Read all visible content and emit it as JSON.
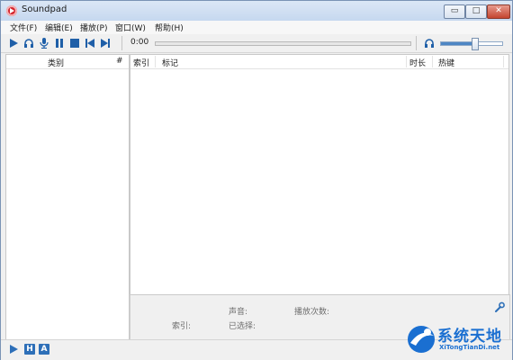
{
  "window": {
    "title": "Soundpad",
    "buttons": {
      "minimize": "▭",
      "maximize": "□",
      "close": "✕"
    }
  },
  "menu": [
    {
      "label": "文件(F)"
    },
    {
      "label": "编辑(E)"
    },
    {
      "label": "播放(P)"
    },
    {
      "label": "窗口(W)"
    },
    {
      "label": "帮助(H)"
    }
  ],
  "toolbar": {
    "icons": [
      "play-icon",
      "headphones-icon",
      "microphone-icon",
      "pause-icon",
      "stop-icon",
      "previous-icon",
      "next-icon"
    ],
    "time": "0:00",
    "progress": 0,
    "volume": 0.55,
    "volume_icon": "headphones-icon"
  },
  "categories": {
    "header_name": "类别",
    "header_count": "#",
    "items": []
  },
  "sound_list": {
    "columns": [
      "索引",
      "标记",
      "时长",
      "热键"
    ],
    "rows": []
  },
  "info": {
    "volume_label": "声音:",
    "play_count_label": "播放次数:",
    "index_label": "索引:",
    "selected_label": "已选择:",
    "settings_icon": "wrench-icon"
  },
  "statusbar": {
    "play_icon": "play-icon",
    "h_label": "H",
    "a_label": "A"
  },
  "watermark": {
    "text": "系统天地",
    "subtext": "XiTongTianDi.net"
  },
  "colors": {
    "accent": "#2d6fb8",
    "close": "#c4442f",
    "icon_blue": "#1f5fa8"
  }
}
